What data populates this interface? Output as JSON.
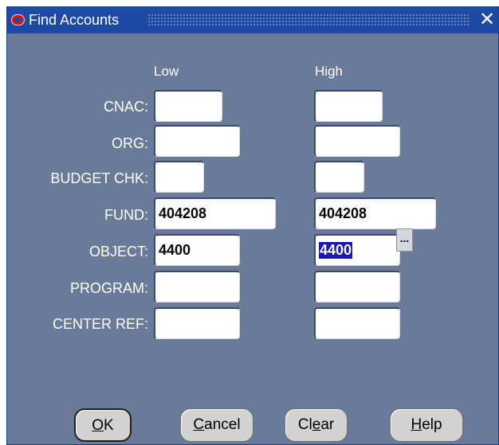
{
  "window": {
    "title": "Find Accounts"
  },
  "columns": {
    "low": "Low",
    "high": "High"
  },
  "rows": [
    {
      "label": "CNAC:",
      "low": "",
      "high": ""
    },
    {
      "label": "ORG:",
      "low": "",
      "high": ""
    },
    {
      "label": "BUDGET CHK:",
      "low": "",
      "high": ""
    },
    {
      "label": "FUND:",
      "low": "404208",
      "high": "404208"
    },
    {
      "label": "OBJECT:",
      "low": "4400",
      "high": "4400"
    },
    {
      "label": "PROGRAM:",
      "low": "",
      "high": ""
    },
    {
      "label": "CENTER REF:",
      "low": "",
      "high": ""
    }
  ],
  "lov_button": {
    "label": "..."
  },
  "buttons": {
    "ok": {
      "mnemonic": "O",
      "rest": "K"
    },
    "cancel": {
      "mnemonic": "C",
      "rest": "ancel"
    },
    "clear": {
      "pre": "Cl",
      "mnemonic": "e",
      "rest": "ar"
    },
    "help": {
      "mnemonic": "H",
      "rest": "elp"
    }
  }
}
